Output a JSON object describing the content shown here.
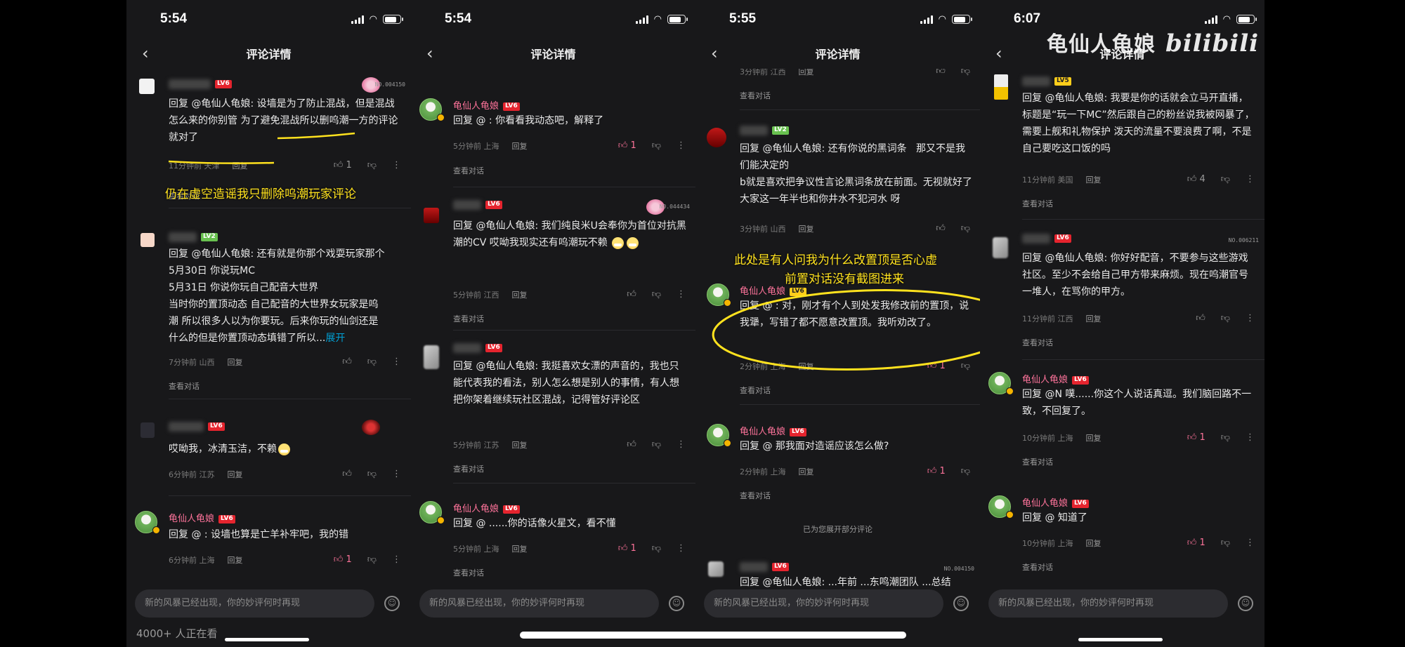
{
  "common": {
    "page_title": "评论详情",
    "back_glyph": "‹",
    "input_placeholder": "新的风暴已经出现，你的妙评何时再现",
    "reply_label": "回复",
    "view_conversation": "查看对话",
    "expand": "展开",
    "expanded_all": "已为您展开部分评论",
    "watching": "4000+ 人正在看",
    "author_name": "龟仙人龟娘",
    "colors": {
      "background": "#18181a",
      "pink": "#fb7299",
      "annotation": "#ffe21e",
      "level_red": "#e5242e",
      "link_blue": "#00a1d6"
    }
  },
  "watermark": {
    "name": "龟仙人龟娘",
    "brand": "bilibili"
  },
  "annotations": {
    "p0": "仍在虚空造谣我只删除呜潮玩家评论",
    "p2_line1": "此处是有人问我为什么改置顶是否心虚",
    "p2_line2": "前置对话没有截图进来"
  },
  "panels": [
    {
      "time": "5:54",
      "comments": [
        {
          "level": "LV6",
          "badge": "NO.004150",
          "text": "回复 @龟仙人龟娘: 设墙是为了防止混战，但是混战怎么来的你别管 为了避免混战所以删呜潮一方的评论就对了",
          "meta": "11分钟前 天津",
          "likes": "1"
        },
        {
          "level": "LV2",
          "text_lines": [
            "回复 @龟仙人龟娘: 还有就是你那个戏耍玩家那个",
            "5月30日   你说玩MC",
            "5月31日   你说你玩自己配音大世界",
            "当时你的置顶动态  自己配音的大世界女玩家是呜",
            "潮  所以很多人以为你要玩。后来你玩的仙剑还是",
            "什么的但是你置顶动态填错了所以..."
          ],
          "meta": "7分钟前 山西"
        },
        {
          "level": "LV6",
          "text": "哎呦我，冰清玉洁，不赖",
          "meta": "6分钟前 江苏"
        },
        {
          "name": "龟仙人龟娘",
          "level": "LV6",
          "text": "回复 @      : 设墙也算是亡羊补牢吧，我的错",
          "meta": "6分钟前 上海",
          "likes": "1"
        }
      ]
    },
    {
      "time": "5:54",
      "comments": [
        {
          "name": "龟仙人龟娘",
          "level": "LV6",
          "text": "回复 @      : 你看看我动态吧，解释了",
          "meta": "5分钟前 上海",
          "likes": "1"
        },
        {
          "level": "LV6",
          "badge": "NO.044434",
          "text": "回复 @龟仙人龟娘: 我们纯良米U会奉你为首位对抗黑潮的CV 哎呦我现实还有呜潮玩不赖",
          "meta": "5分钟前 江西"
        },
        {
          "level": "LV6",
          "text": "回复 @龟仙人龟娘: 我挺喜欢女漂的声音的，我也只能代表我的看法，别人怎么想是别人的事情，有人想把你架着继续玩社区混战，记得管好评论区",
          "meta": "5分钟前 江苏"
        },
        {
          "name": "龟仙人龟娘",
          "level": "LV6",
          "text": "回复 @      ......你的话像火星文，看不懂",
          "meta": "5分钟前 上海",
          "likes": "1"
        }
      ]
    },
    {
      "time": "5:55",
      "comments": [
        {
          "meta_top": "3分钟前 江西"
        },
        {
          "level": "LV2",
          "text": "回复 @龟仙人龟娘: 还有你说的黑词条   那又不是我们能决定的\nb就是喜欢把争议性言论黑词条放在前面。无视就好了 大家这一年半也和你井水不犯河水 呀",
          "meta": "3分钟前 山西"
        },
        {
          "name": "龟仙人龟娘",
          "level": "LV6",
          "text": "回复 @         : 对，刚才有个人到处发我修改前的置顶，说我犟，写错了都不愿意改置顶。我听劝改了。",
          "meta": "2分钟前 上海",
          "likes": "1"
        },
        {
          "name": "龟仙人龟娘",
          "level": "LV6",
          "text": "回复 @         那我面对造谣应该怎么做?",
          "meta": "2分钟前 上海",
          "likes": "1"
        },
        {
          "level": "LV6",
          "badge": "NO.004150",
          "text": "回复 @龟仙人龟娘: ...年前 ...东鸣潮团队 ...总结",
          "meta": ""
        }
      ]
    },
    {
      "time": "6:07",
      "comments": [
        {
          "level": "LV5",
          "text": "回复 @龟仙人龟娘: 我要是你的话就会立马开直播，标题是“玩一下MC”然后跟自己的粉丝说我被网暴了，需要上舰和礼物保护 泼天的流量不要浪费了啊，不是自己要吃这口饭的吗",
          "meta": "11分钟前 美国",
          "likes": "4"
        },
        {
          "level": "LV6",
          "badge": "NO.006211",
          "text": "回复 @龟仙人龟娘: 你好好配音，不要参与这些游戏社区。至少不会给自己甲方带来麻烦。现在呜潮官号一堆人，在骂你的甲方。",
          "meta": "11分钟前 江西"
        },
        {
          "name": "龟仙人龟娘",
          "level": "LV6",
          "text": "回复 @N         噗......你这个人说话真逗。我们脑回路不一致，不回复了。",
          "meta": "10分钟前 上海",
          "likes": "1"
        },
        {
          "name": "龟仙人龟娘",
          "level": "LV6",
          "text": "回复 @                   知道了",
          "meta": "10分钟前 上海",
          "likes": "1"
        }
      ]
    }
  ]
}
